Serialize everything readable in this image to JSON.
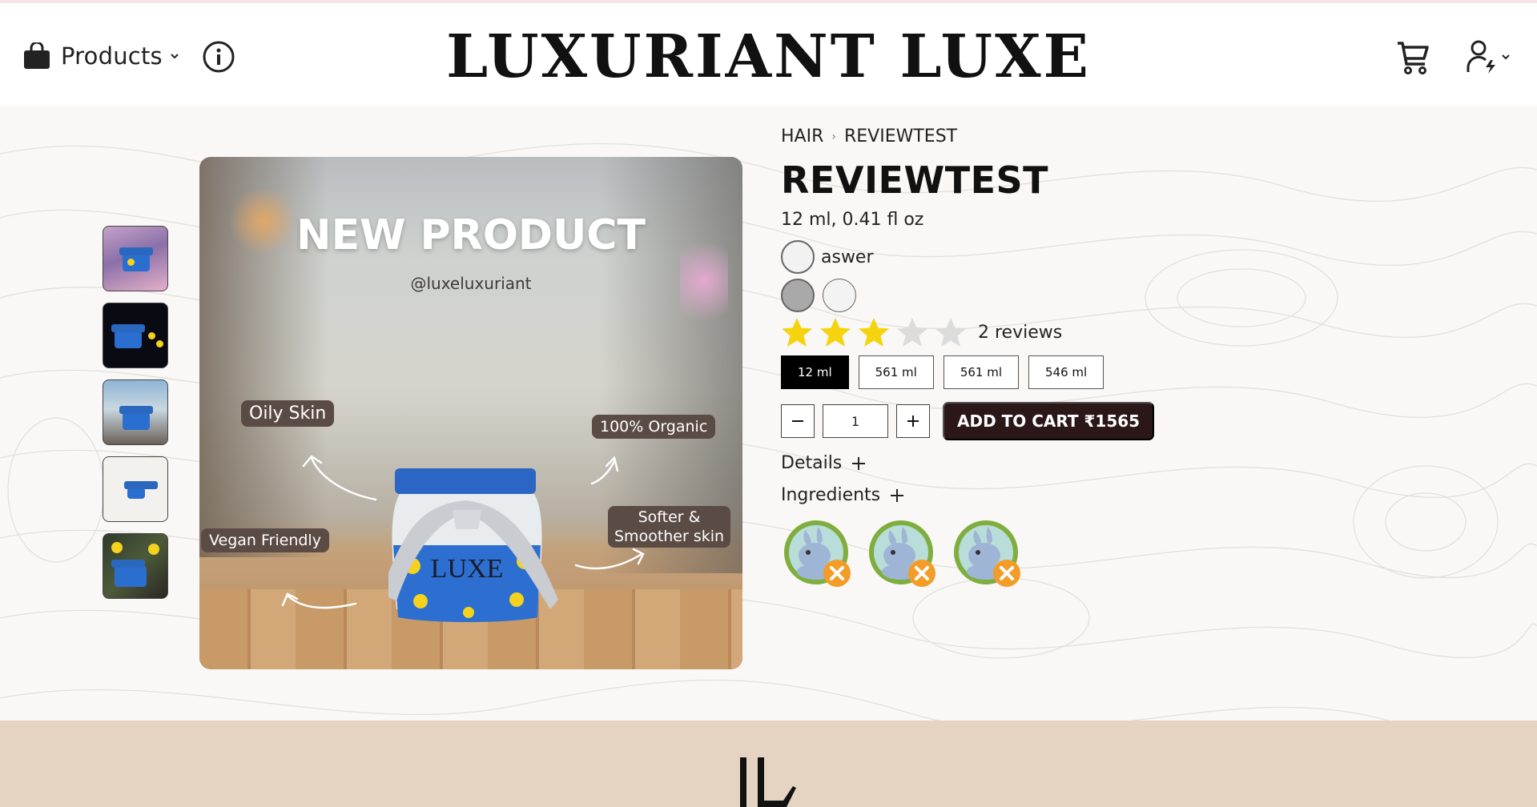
{
  "header": {
    "products_label": "Products",
    "brand": "LUXURIANT LUXE",
    "icons": [
      "shopping-bag-icon",
      "chevron-down-icon",
      "info-icon",
      "cart-icon",
      "user-icon"
    ]
  },
  "gallery": {
    "thumbnails": [
      "thumbnail-1",
      "thumbnail-2",
      "thumbnail-3",
      "thumbnail-4",
      "thumbnail-5"
    ],
    "hero": {
      "title": "NEW PRODUCT",
      "handle": "@luxeluxuriant",
      "tags": {
        "oily": "Oily Skin",
        "organic": "100% Organic",
        "vegan": "Vegan Friendly",
        "softer_line1": "Softer &",
        "softer_line2": "Smoother skin"
      }
    }
  },
  "product": {
    "breadcrumb": [
      "HAIR",
      "REVIEWTEST"
    ],
    "title": "REVIEWTEST",
    "size_text": "12 ml, 0.41 fl oz",
    "variant_label": "aswer",
    "rating": 3,
    "rating_max": 5,
    "reviews": "2 reviews",
    "sizes": [
      "12 ml",
      "561 ml",
      "561 ml",
      "546 ml"
    ],
    "selected_size": "12 ml",
    "quantity": "1",
    "add_to_cart": "ADD TO CART ₹1565",
    "details_label": "Details",
    "ingredients_label": "Ingredients",
    "badges": [
      "cruelty-free-icon",
      "cruelty-free-icon",
      "cruelty-free-icon"
    ]
  },
  "colors": {
    "accent_dark": "#2b1717",
    "star_filled": "#f5d40f",
    "star_empty": "#dcdcdc",
    "footer_bg": "#e4d4c1"
  }
}
